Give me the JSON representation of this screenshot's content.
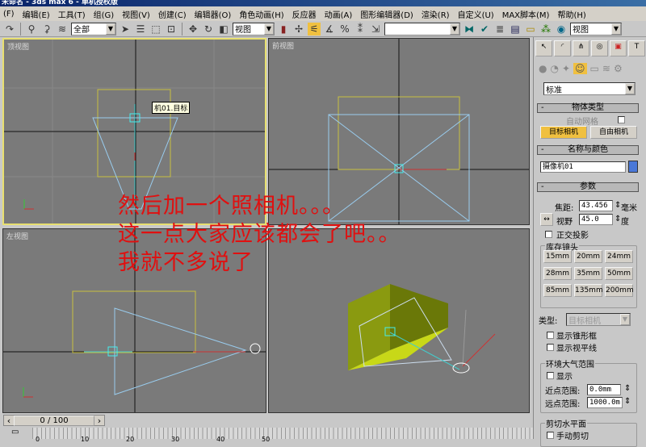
{
  "title": "未命名 - 3ds max 6 - 单机授权版",
  "menu": [
    "(F)",
    "编辑(E)",
    "工具(T)",
    "组(G)",
    "视图(V)",
    "创建(C)",
    "编辑器(O)",
    "角色动画(H)",
    "反应器",
    "动画(A)",
    "图形编辑器(D)",
    "渲染(R)",
    "自定义(U)",
    "MAX脚本(M)",
    "帮助(H)"
  ],
  "toolbar": {
    "selection_filter": "全部",
    "ref_coord": "视图",
    "named_selection": "",
    "view_select": "视图"
  },
  "viewports": {
    "top": "顶视图",
    "front": "前视图",
    "left": "左视图",
    "camera_target_label": "机01.目标"
  },
  "overlay": [
    "然后加一个照相机。。。",
    "这一点大家应该都会了吧。。",
    "我就不多说了"
  ],
  "panel": {
    "dropdown": "标准",
    "object_type": {
      "title": "物体类型",
      "autogrid": "自动网格",
      "target_camera": "目标相机",
      "free_camera": "自由相机"
    },
    "name_color": {
      "title": "名称与颜色",
      "name": "摄像机01",
      "color": "#4a78d8"
    },
    "params": {
      "title": "参数",
      "focal_label": "焦距:",
      "focal": "43.456",
      "focal_unit": "毫米",
      "fov_label": "视野",
      "fov": "45.0",
      "fov_unit": "度",
      "ortho": "正交投影",
      "stock_lens": "库存镜头",
      "lenses": [
        "15mm",
        "20mm",
        "24mm",
        "28mm",
        "35mm",
        "50mm",
        "85mm",
        "135mm",
        "200mm"
      ],
      "type_label": "类型:",
      "type": "目标相机",
      "show_cone": "显示锥形框",
      "show_horizon": "显示视平线",
      "env_ranges": "环境大气范围",
      "show": "显示",
      "near_label": "近点范围:",
      "near": "0.0mm",
      "far_label": "远点范围:",
      "far": "1000.0m",
      "clipping": "剪切水平面",
      "manual_clip": "手动剪切"
    }
  },
  "timeline": {
    "frame": "0 / 100",
    "ticks": [
      "0",
      "10",
      "20",
      "30",
      "40",
      "50"
    ]
  }
}
